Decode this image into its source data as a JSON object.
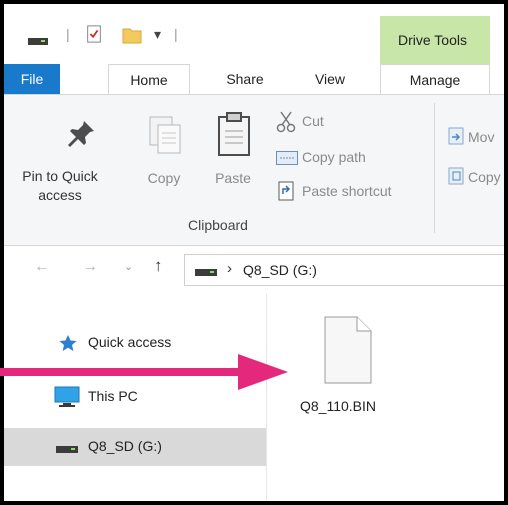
{
  "qat": {
    "separator_glyph": "|",
    "dropdown_glyph": "▾"
  },
  "context_tab": {
    "label": "Drive Tools",
    "color": "#c7e6a7"
  },
  "tabs": [
    {
      "label": "File"
    },
    {
      "label": "Home"
    },
    {
      "label": "Share"
    },
    {
      "label": "View"
    },
    {
      "label": "Manage"
    }
  ],
  "ribbon": {
    "pin": {
      "label": "Pin to Quick access"
    },
    "copy": {
      "label": "Copy"
    },
    "paste": {
      "label": "Paste"
    },
    "cut": {
      "label": "Cut"
    },
    "copy_path": {
      "label": "Copy path"
    },
    "paste_shortcut": {
      "label": "Paste shortcut"
    },
    "clipboard_group": {
      "label": "Clipboard"
    },
    "move_to": {
      "label": "Mov"
    },
    "copy_to": {
      "label": "Copy"
    }
  },
  "address": {
    "path": "Q8_SD (G:)",
    "chevron": "›"
  },
  "nav": [
    {
      "label": "Quick access",
      "icon": "star-icon"
    },
    {
      "label": "This PC",
      "icon": "pc-icon"
    },
    {
      "label": "Q8_SD (G:)",
      "icon": "drive-icon",
      "selected": true
    }
  ],
  "files": [
    {
      "name": "Q8_110.BIN",
      "icon": "file-icon"
    }
  ],
  "colors": {
    "file_tab": "#1979ca",
    "arrow": "#e4287c",
    "selected_nav": "#d9d9d9"
  }
}
